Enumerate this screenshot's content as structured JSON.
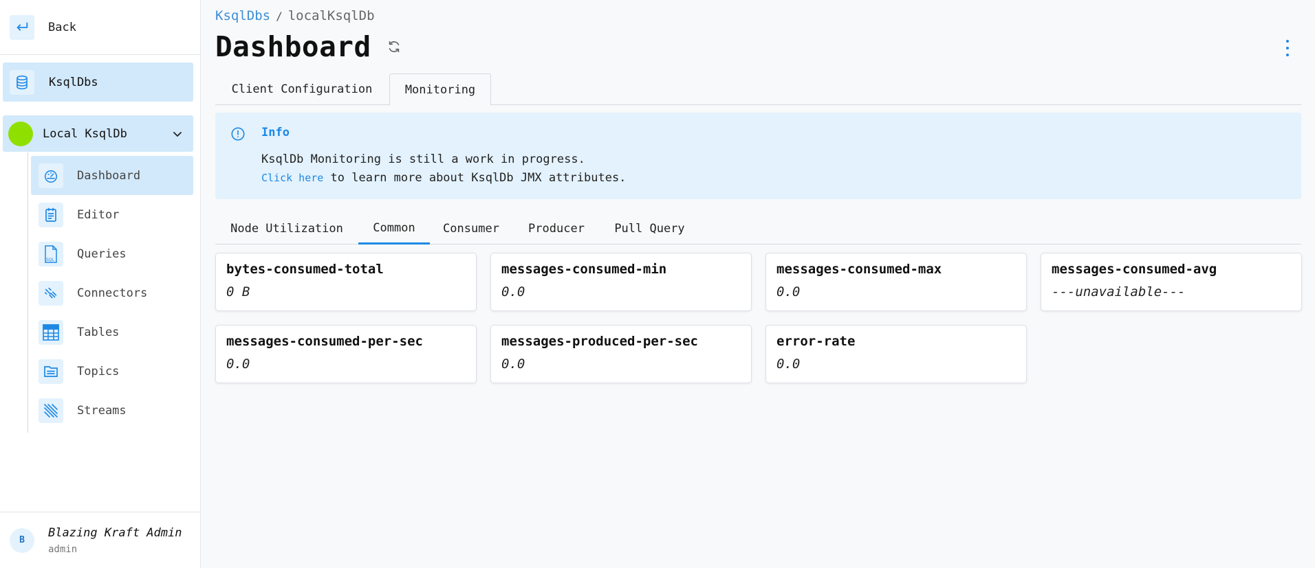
{
  "sidebar": {
    "back_label": "Back",
    "ksqldbs_label": "KsqlDbs",
    "environment_label": "Local KsqlDb",
    "environment_color": "#8fe000",
    "items": [
      {
        "label": "Dashboard",
        "icon": "dashboard-gauge-icon",
        "active": true
      },
      {
        "label": "Editor",
        "icon": "editor-icon"
      },
      {
        "label": "Queries",
        "icon": "sql-file-icon"
      },
      {
        "label": "Connectors",
        "icon": "connectors-icon"
      },
      {
        "label": "Tables",
        "icon": "table-icon"
      },
      {
        "label": "Topics",
        "icon": "topics-icon"
      },
      {
        "label": "Streams",
        "icon": "streams-icon"
      }
    ],
    "user": {
      "initial": "B",
      "name": "Blazing Kraft Admin",
      "role": "admin"
    }
  },
  "breadcrumb": {
    "parent": "KsqlDbs",
    "separator": "/",
    "current": "localKsqlDb"
  },
  "page_title": "Dashboard",
  "top_tabs": [
    {
      "label": "Client Configuration",
      "active": false
    },
    {
      "label": "Monitoring",
      "active": true
    }
  ],
  "info": {
    "title": "Info",
    "line1": "KsqlDb Monitoring is still a work in progress.",
    "link_text": "Click here",
    "line2_rest": " to learn more about KsqlDb JMX attributes."
  },
  "sub_tabs": [
    {
      "label": "Node Utilization",
      "active": false
    },
    {
      "label": "Common",
      "active": true
    },
    {
      "label": "Consumer",
      "active": false
    },
    {
      "label": "Producer",
      "active": false
    },
    {
      "label": "Pull Query",
      "active": false
    }
  ],
  "metrics": [
    {
      "name": "bytes-consumed-total",
      "value": "0 B"
    },
    {
      "name": "messages-consumed-min",
      "value": "0.0"
    },
    {
      "name": "messages-consumed-max",
      "value": "0.0"
    },
    {
      "name": "messages-consumed-avg",
      "value": "---unavailable---"
    },
    {
      "name": "messages-consumed-per-sec",
      "value": "0.0"
    },
    {
      "name": "messages-produced-per-sec",
      "value": "0.0"
    },
    {
      "name": "error-rate",
      "value": "0.0"
    }
  ],
  "colors": {
    "accent": "#1e88e5",
    "active_bg": "#d2e9fb",
    "info_bg": "#e3f2fd"
  }
}
